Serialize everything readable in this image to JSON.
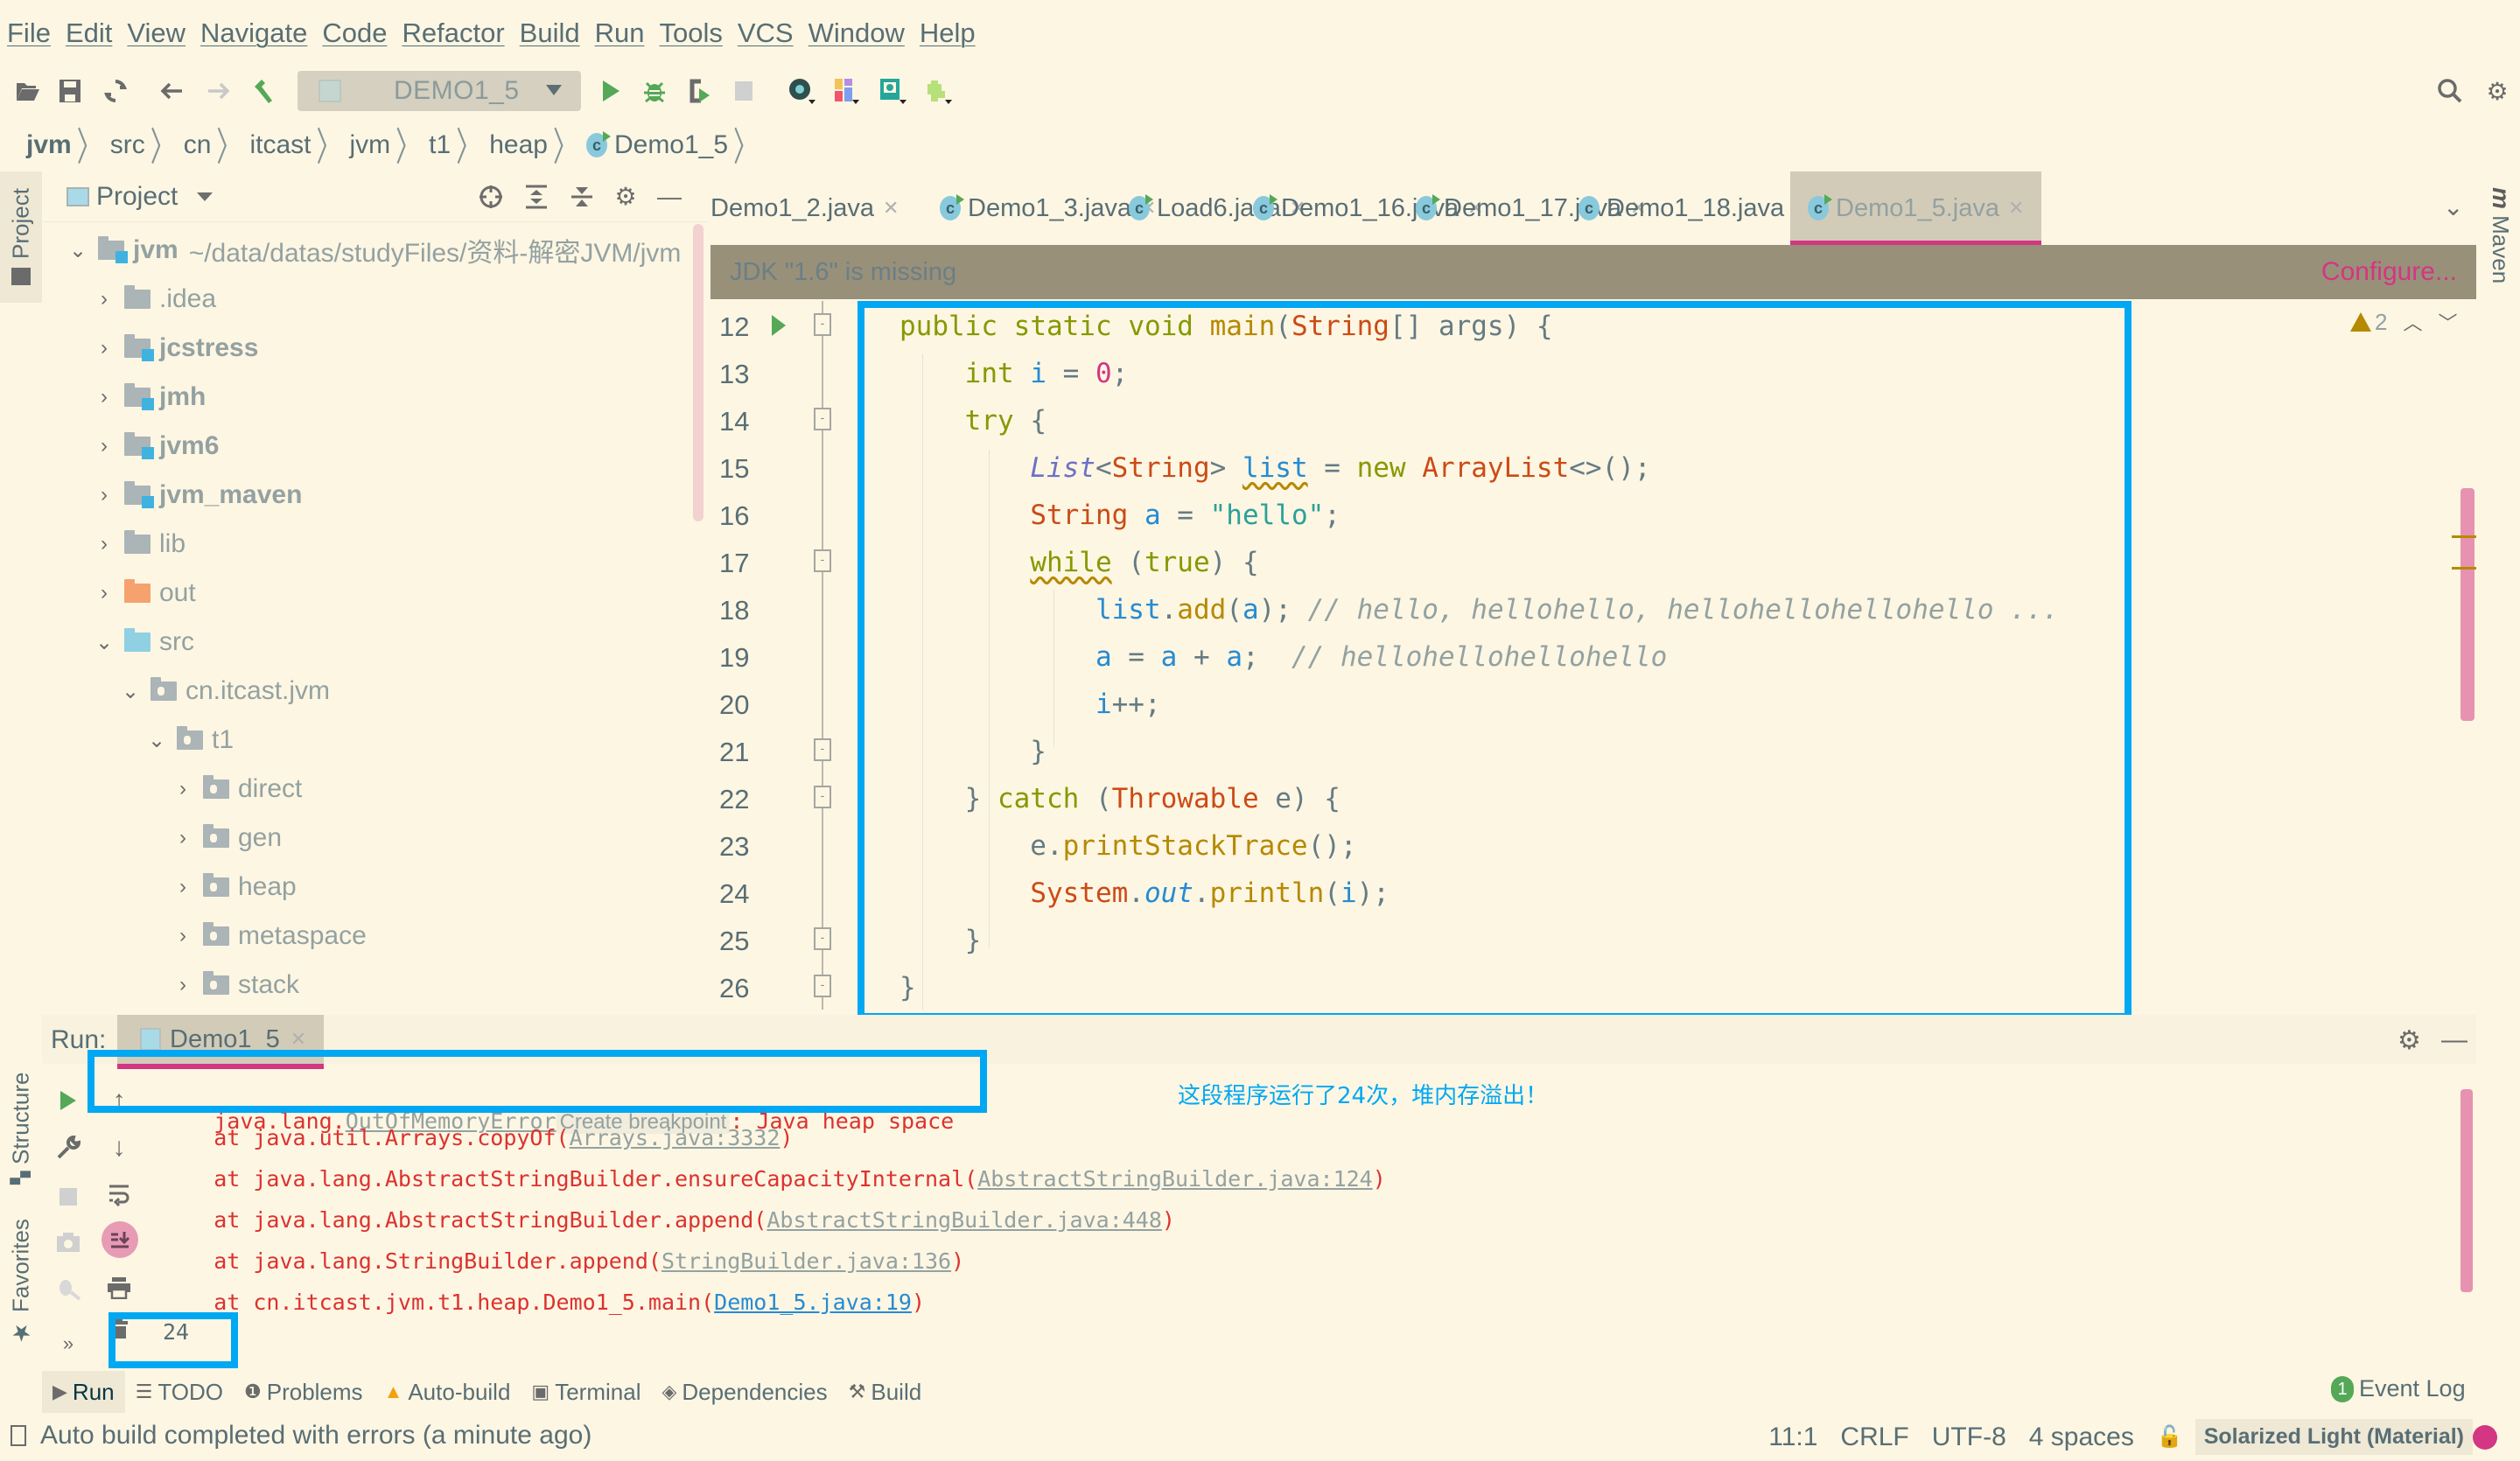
{
  "menu": [
    "File",
    "Edit",
    "View",
    "Navigate",
    "Code",
    "Refactor",
    "Build",
    "Run",
    "Tools",
    "VCS",
    "Window",
    "Help"
  ],
  "toolbar": {
    "run_config": "DEMO1_5",
    "icons": [
      "open-folder-icon",
      "save-icon",
      "sync-icon",
      "back-icon",
      "forward-icon",
      "build-hammer-icon",
      "run-icon",
      "debug-icon",
      "coverage-icon",
      "stop-icon",
      "profiler-icon",
      "layout-icon",
      "jrebel-icon",
      "plugin-icon",
      "search-icon",
      "settings-icon"
    ]
  },
  "breadcrumb": [
    "jvm",
    "src",
    "cn",
    "itcast",
    "jvm",
    "t1",
    "heap",
    "Demo1_5"
  ],
  "left_stripe": {
    "project": "Project",
    "structure": "Structure",
    "favorites": "Favorites"
  },
  "project_panel": {
    "title": "Project",
    "tree": [
      {
        "label": "jvm",
        "path": "~/data/datas/studyFiles/资料-解密JVM/jvm",
        "expanded": true,
        "depth": 0,
        "kind": "module"
      },
      {
        "label": ".idea",
        "expanded": false,
        "depth": 1,
        "kind": "folder"
      },
      {
        "label": "jcstress",
        "expanded": false,
        "depth": 1,
        "kind": "module"
      },
      {
        "label": "jmh",
        "expanded": false,
        "depth": 1,
        "kind": "module"
      },
      {
        "label": "jvm6",
        "expanded": false,
        "depth": 1,
        "kind": "module"
      },
      {
        "label": "jvm_maven",
        "expanded": false,
        "depth": 1,
        "kind": "module"
      },
      {
        "label": "lib",
        "expanded": false,
        "depth": 1,
        "kind": "folder"
      },
      {
        "label": "out",
        "expanded": false,
        "depth": 1,
        "kind": "out"
      },
      {
        "label": "src",
        "expanded": true,
        "depth": 1,
        "kind": "src"
      },
      {
        "label": "cn.itcast.jvm",
        "expanded": true,
        "depth": 2,
        "kind": "pkg"
      },
      {
        "label": "t1",
        "expanded": true,
        "depth": 3,
        "kind": "pkg"
      },
      {
        "label": "direct",
        "expanded": false,
        "depth": 4,
        "kind": "pkg"
      },
      {
        "label": "gen",
        "expanded": false,
        "depth": 4,
        "kind": "pkg"
      },
      {
        "label": "heap",
        "expanded": false,
        "depth": 4,
        "kind": "pkg"
      },
      {
        "label": "metaspace",
        "expanded": false,
        "depth": 4,
        "kind": "pkg"
      },
      {
        "label": "stack",
        "expanded": false,
        "depth": 4,
        "kind": "pkg"
      }
    ]
  },
  "editor": {
    "tabs": [
      {
        "label": "Demo1_2.java",
        "active": false
      },
      {
        "label": "Demo1_3.java",
        "active": false
      },
      {
        "label": "Load6.java",
        "active": false
      },
      {
        "label": "Demo1_16.java",
        "active": false
      },
      {
        "label": "Demo1_17.java",
        "active": false
      },
      {
        "label": "Demo1_18.java",
        "active": false
      },
      {
        "label": "Demo1_5.java",
        "active": true
      }
    ],
    "banner": {
      "message": "JDK \"1.6\" is missing",
      "action": "Configure..."
    },
    "warning_count": "2",
    "line_numbers": [
      "12",
      "13",
      "14",
      "15",
      "16",
      "17",
      "18",
      "19",
      "20",
      "21",
      "22",
      "23",
      "24",
      "25",
      "26"
    ],
    "code_lines": [
      "public static void main(String[] args) {",
      "    int i = 0;",
      "    try {",
      "        List<String> list = new ArrayList<>();",
      "        String a = \"hello\";",
      "        while (true) {",
      "            list.add(a); // hello, hellohello, hellohellohellohello ...",
      "            a = a + a;  // hellohellohellohello",
      "            i++;",
      "        }",
      "    } catch (Throwable e) {",
      "        e.printStackTrace();",
      "        System.out.println(i);",
      "    }",
      "}"
    ]
  },
  "run_panel": {
    "label": "Run:",
    "tab": "Demo1_5",
    "console": {
      "exception_prefix": "java.lang.",
      "exception_class": "OutOfMemoryError",
      "create_breakpoint": "Create breakpoint",
      "exception_suffix": ": Java heap space",
      "stack": [
        {
          "at": "    at java.util.Arrays.copyOf(",
          "link": "Arrays.java:3332",
          "end": ")"
        },
        {
          "at": "    at java.lang.AbstractStringBuilder.ensureCapacityInternal(",
          "link": "AbstractStringBuilder.java:124",
          "end": ")"
        },
        {
          "at": "    at java.lang.AbstractStringBuilder.append(",
          "link": "AbstractStringBuilder.java:448",
          "end": ")"
        },
        {
          "at": "    at java.lang.StringBuilder.append(",
          "link": "StringBuilder.java:136",
          "end": ")"
        },
        {
          "at": "    at cn.itcast.jvm.t1.heap.Demo1_5.main(",
          "link": "Demo1_5.java:19",
          "end": ")"
        }
      ],
      "output": "24"
    },
    "annotation": "这段程序运行了24次，堆内存溢出！"
  },
  "bottom_tabs": [
    "Run",
    "TODO",
    "Problems",
    "Auto-build",
    "Terminal",
    "Dependencies",
    "Build"
  ],
  "event_log": {
    "label": "Event Log",
    "count": "1"
  },
  "status": {
    "message": "Auto build completed with errors (a minute ago)",
    "position": "11:1",
    "line_sep": "CRLF",
    "encoding": "UTF-8",
    "indent": "4 spaces",
    "theme": "Solarized Light (Material)"
  },
  "colors": {
    "accent": "#d33682",
    "highlight_box": "#00a8f3",
    "background": "#fdf6e3",
    "banner": "#99907a"
  }
}
